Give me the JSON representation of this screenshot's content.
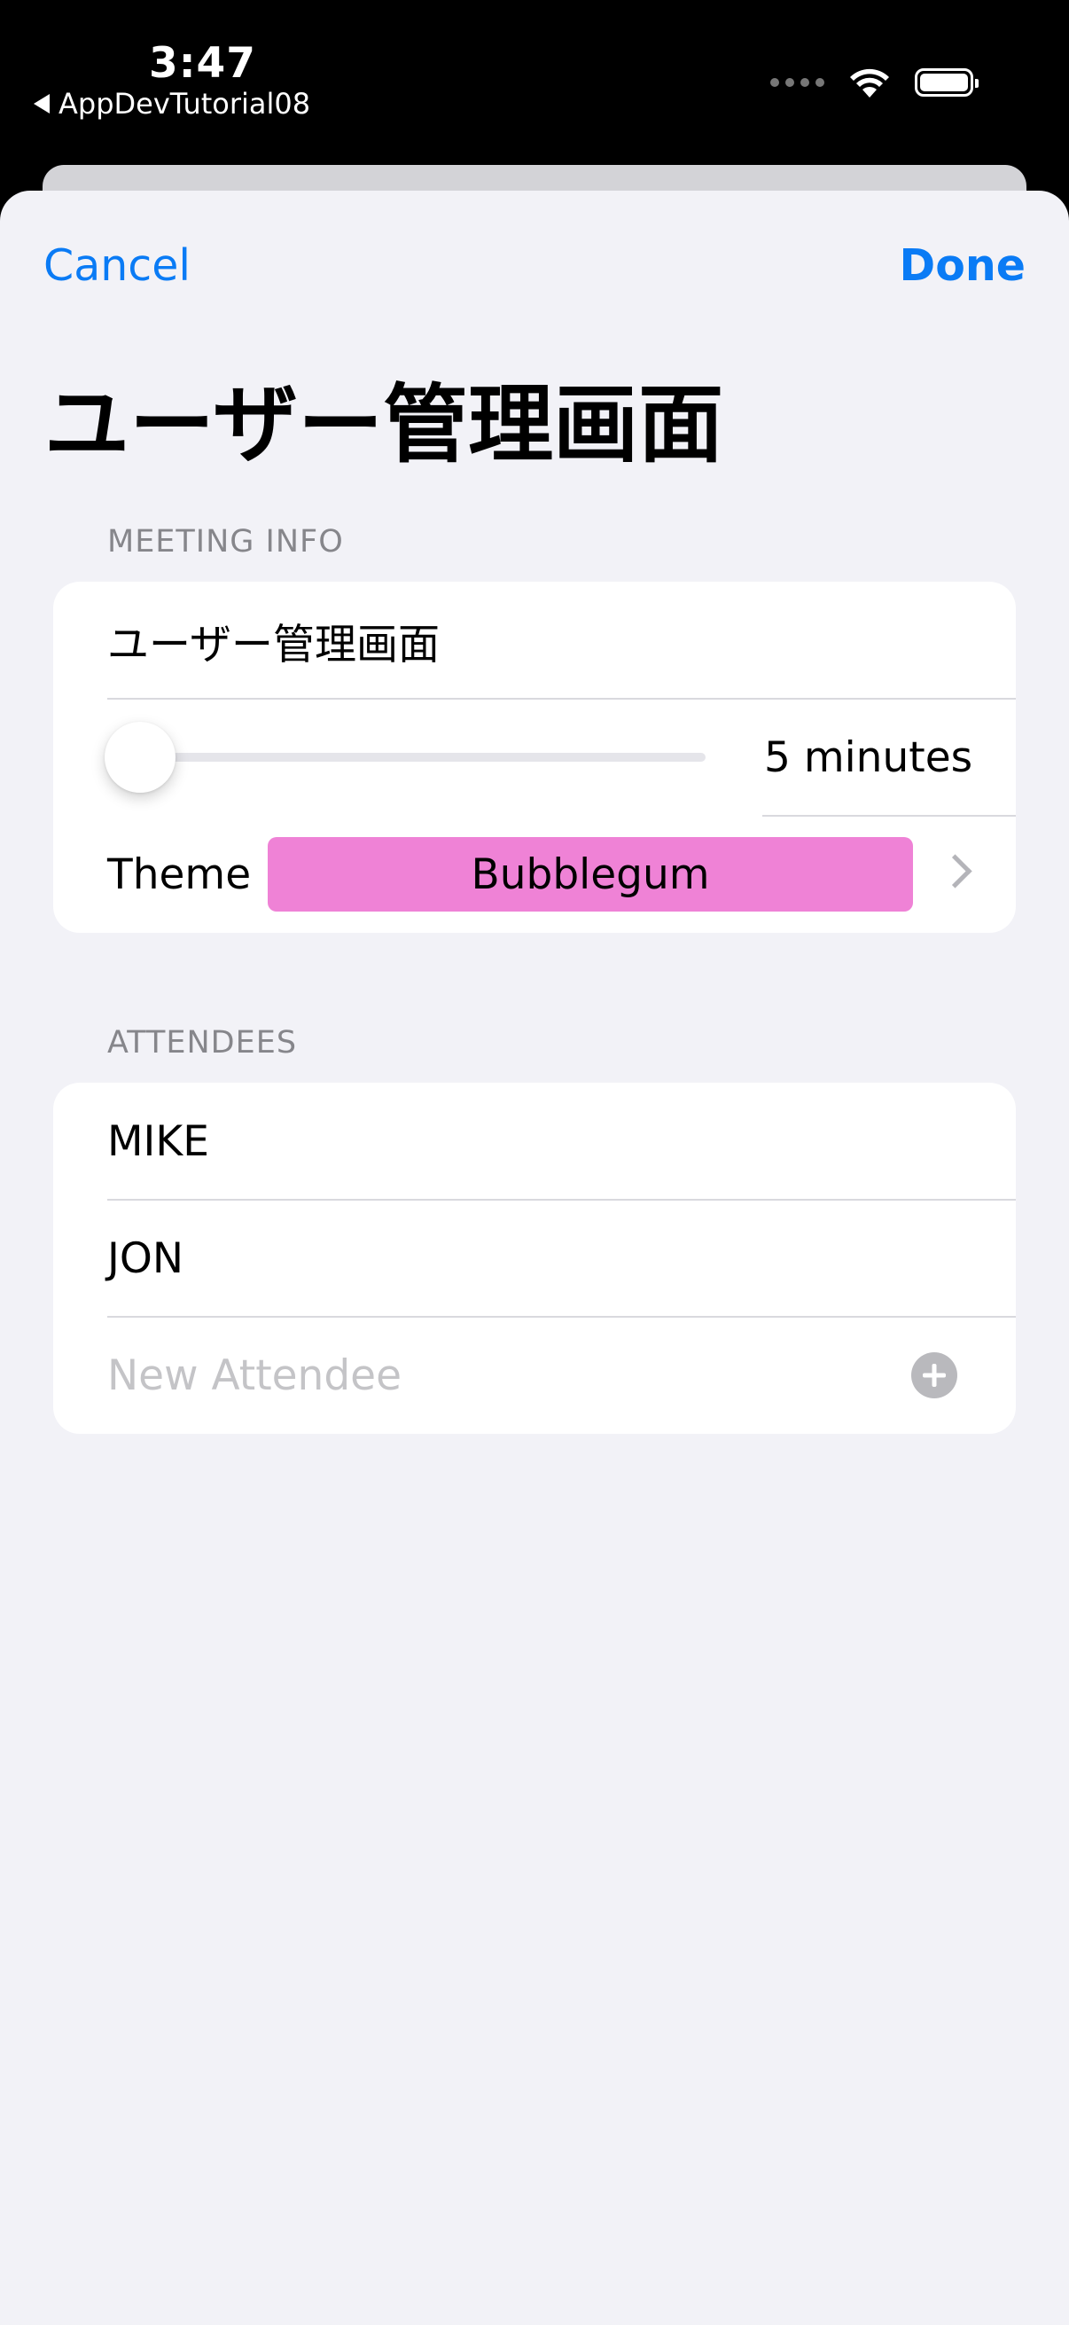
{
  "status_bar": {
    "time": "3:47",
    "back_app": "AppDevTutorial08"
  },
  "nav": {
    "cancel_label": "Cancel",
    "done_label": "Done"
  },
  "page_title": "ユーザー管理画面",
  "meeting_info": {
    "header": "MEETING INFO",
    "title_value": "ユーザー管理画面",
    "length_label": "5 minutes",
    "length_slider_fraction": 0.0,
    "theme_label": "Theme",
    "theme_value": "Bubblegum",
    "theme_color": "#ef82d6"
  },
  "attendees": {
    "header": "ATTENDEES",
    "items": [
      "MIKE",
      "JON"
    ],
    "new_placeholder": "New Attendee"
  },
  "colors": {
    "accent": "#0a7bf5",
    "background": "#f2f2f7"
  }
}
